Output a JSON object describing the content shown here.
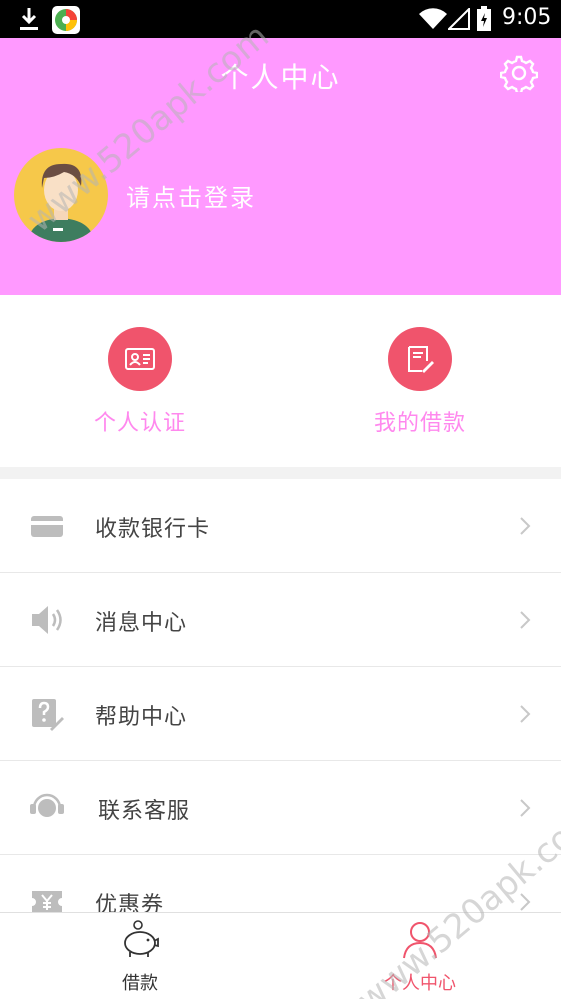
{
  "status_bar": {
    "time": "9:05",
    "download_icon": "download-icon",
    "app_icon": "app-notification-icon",
    "wifi_icon": "wifi-icon",
    "signal_icon": "cell-signal-icon",
    "battery_icon": "battery-icon"
  },
  "header": {
    "title": "个人中心",
    "settings_icon": "gear-icon",
    "login_prompt": "请点击登录",
    "background_color": "#ff99ff"
  },
  "quick_actions": [
    {
      "label": "个人认证",
      "icon": "id-card-icon"
    },
    {
      "label": "我的借款",
      "icon": "loan-document-icon"
    }
  ],
  "menu": {
    "items": [
      {
        "label": "收款银行卡",
        "icon": "bank-card-icon"
      },
      {
        "label": "消息中心",
        "icon": "speaker-icon"
      },
      {
        "label": "帮助中心",
        "icon": "help-icon"
      },
      {
        "label": "联系客服",
        "icon": "headset-icon"
      },
      {
        "label": "优惠券",
        "icon": "coupon-icon"
      }
    ]
  },
  "tab_bar": {
    "tabs": [
      {
        "label": "借款",
        "icon": "piggy-bank-icon",
        "active": false
      },
      {
        "label": "个人中心",
        "icon": "person-icon",
        "active": true
      }
    ]
  },
  "watermark": "www.520apk.com",
  "colors": {
    "accent": "#f0546c",
    "header": "#ff99ff",
    "quick_label": "#ff88ee"
  }
}
